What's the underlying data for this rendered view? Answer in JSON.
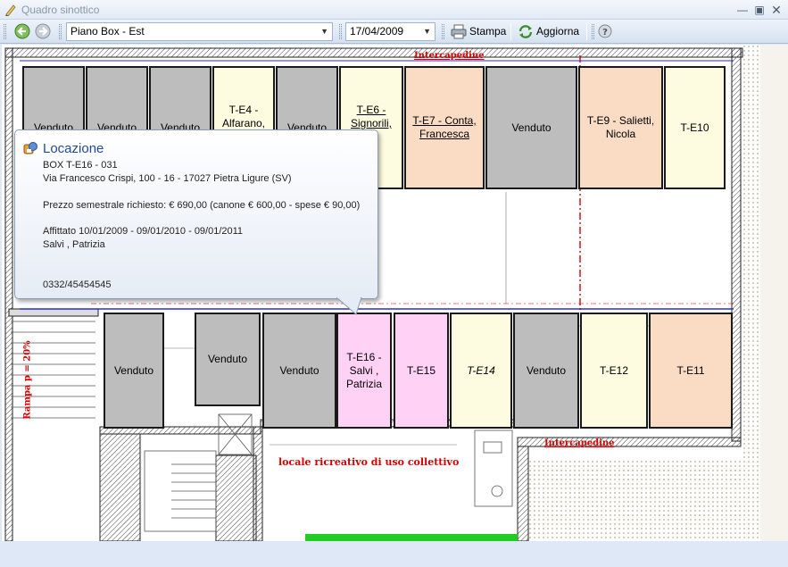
{
  "window": {
    "title": "Quadro sinottico"
  },
  "toolbar": {
    "floor_value": "Piano Box - Est",
    "date_value": "17/04/2009",
    "print_label": "Stampa",
    "refresh_label": "Aggiorna"
  },
  "drawing": {
    "label_top": "Intercapedine",
    "label_right": "Intercapedine",
    "label_room": "locale ricreativo di uso collettivo",
    "label_ramp": "Rampa p = 20%"
  },
  "boxes_top": [
    {
      "id": "box-top-1",
      "label": "Venduto",
      "status": "sold"
    },
    {
      "id": "box-top-2",
      "label": "Venduto",
      "status": "sold"
    },
    {
      "id": "box-top-3",
      "label": "Venduto",
      "status": "sold"
    },
    {
      "id": "box-t-e4",
      "label": "T-E4 - Alfarano,",
      "status": "yellow"
    },
    {
      "id": "box-top-5",
      "label": "Venduto",
      "status": "sold"
    },
    {
      "id": "box-t-e6",
      "label": "T-E6 - Signorili,",
      "status": "yellow"
    },
    {
      "id": "box-t-e7",
      "label": "T-E7 - Conta, Francesca",
      "status": "orange"
    },
    {
      "id": "box-top-8",
      "label": "Venduto",
      "status": "sold"
    },
    {
      "id": "box-t-e9",
      "label": "T-E9 - Salietti, Nicola",
      "status": "orange"
    },
    {
      "id": "box-t-e10",
      "label": "T-E10",
      "status": "yellow"
    }
  ],
  "boxes_bottom": [
    {
      "id": "box-bot-1",
      "label": "Venduto",
      "status": "sold"
    },
    {
      "id": "box-bot-2",
      "label": "Venduto",
      "status": "sold"
    },
    {
      "id": "box-bot-3",
      "label": "Venduto",
      "status": "sold"
    },
    {
      "id": "box-t-e16",
      "label": "T-E16 - Salvi , Patrizia",
      "status": "pink"
    },
    {
      "id": "box-t-e15",
      "label": "T-E15",
      "status": "pink"
    },
    {
      "id": "box-t-e14",
      "label": "T-E14",
      "status": "yellow"
    },
    {
      "id": "box-bot-7",
      "label": "Venduto",
      "status": "sold"
    },
    {
      "id": "box-t-e12",
      "label": "T-E12",
      "status": "yellow"
    },
    {
      "id": "box-t-e11",
      "label": "T-E11",
      "status": "orange"
    }
  ],
  "tooltip": {
    "title": "Locazione",
    "box_code": "BOX T-E16 - 031",
    "address": "Via Francesco Crispi, 100 - 16 - 17027 Pietra Ligure (SV)",
    "price": "Prezzo semestrale richiesto: € 690,00 (canone € 600,00 - spese € 90,00)",
    "rented": "Affittato 10/01/2009 - 09/01/2010 - 09/01/2011",
    "tenant": "Salvi , Patrizia",
    "phone": "0332/45454545"
  },
  "colors": {
    "sold": "#bdbdbd",
    "yellow": "#fdfbe0",
    "orange": "#fadbc4",
    "pink": "#ffd2f5",
    "accent_red": "#d40000",
    "toolbar_blue": "#dfe8f6"
  }
}
